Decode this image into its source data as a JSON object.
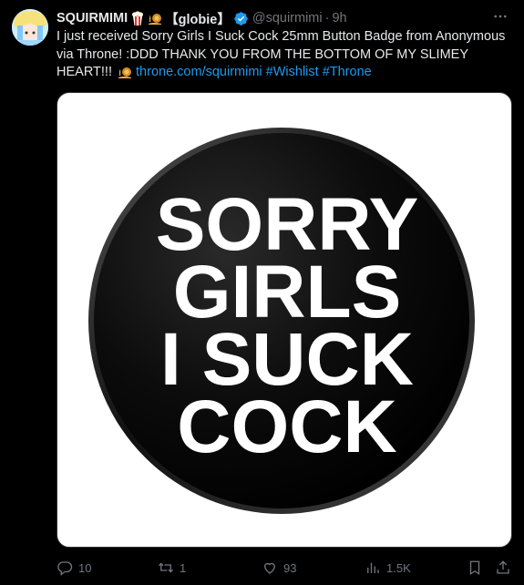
{
  "author": {
    "display_name": "SQUIRMIMI",
    "bracket_name": "【globie】",
    "handle": "@squirmimi",
    "separator": "·",
    "time": "9h"
  },
  "tweet": {
    "text": "I just received Sorry Girls I Suck Cock 25mm Button Badge from Anonymous via Throne! :DDD THANK YOU FROM THE BOTTOM OF MY SLIMEY HEART!!!",
    "link": "throne.com/squirmimi",
    "hashtag1": "#Wishlist",
    "hashtag2": "#Throne"
  },
  "media": {
    "badge_line1": "SORRY",
    "badge_line2": "GIRLS",
    "badge_line3": "I SUCK",
    "badge_line4": "COCK"
  },
  "actions": {
    "replies": "10",
    "reposts": "1",
    "likes": "93",
    "views": "1.5K"
  },
  "colors": {
    "background": "#000000",
    "text": "#e7e9ea",
    "muted": "#71767b",
    "link": "#1d9bf0",
    "verified": "#1d9bf0"
  },
  "icons": [
    "avatar",
    "popcorn-icon",
    "snail-icon",
    "verified-badge-icon",
    "more-icon",
    "reply-icon",
    "repost-icon",
    "like-icon",
    "views-icon",
    "bookmark-icon",
    "share-icon"
  ]
}
